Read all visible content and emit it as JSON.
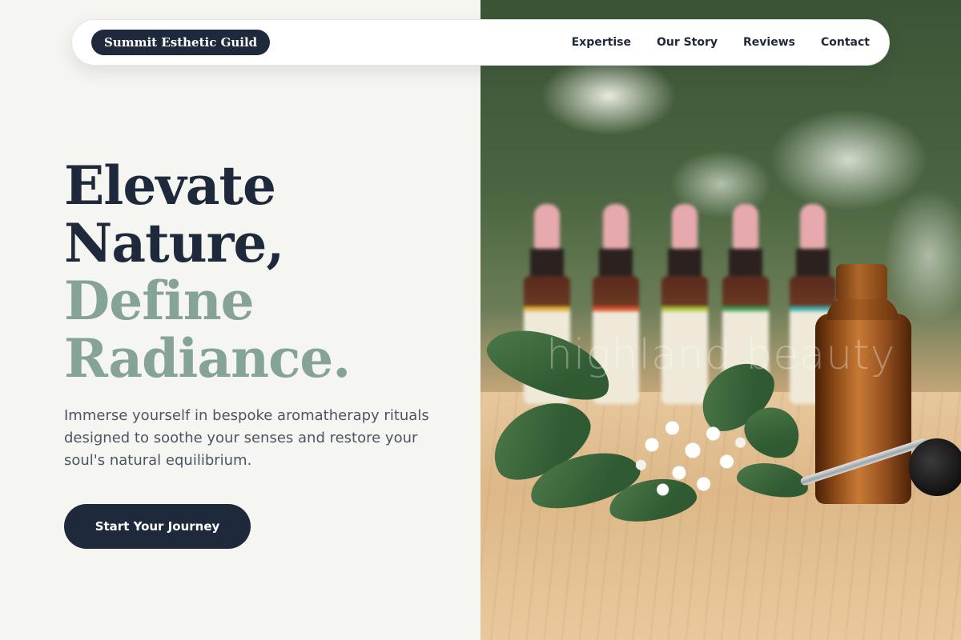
{
  "nav": {
    "brand": "Summit Esthetic Guild",
    "links": [
      "Expertise",
      "Our Story",
      "Reviews",
      "Contact"
    ]
  },
  "hero": {
    "headline_line1": "Elevate",
    "headline_line2": "Nature,",
    "headline_line3": "Define",
    "headline_line4": "Radiance.",
    "subtext": "Immerse yourself in bespoke aromatherapy rituals designed to soothe your senses and restore your soul's natural equilibrium.",
    "cta_label": "Start Your Journey",
    "image_watermark": "highland beauty"
  },
  "colors": {
    "navy": "#1e293b",
    "sage": "#86a397",
    "background": "#f5f5f1",
    "body_text": "#4b5563"
  }
}
